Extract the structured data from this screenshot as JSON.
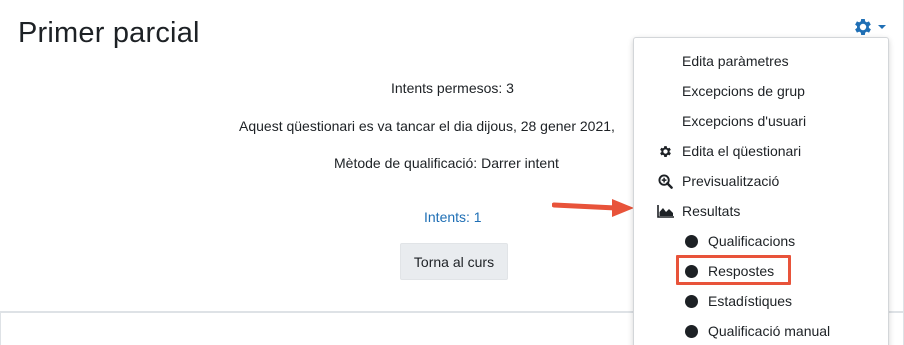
{
  "page": {
    "title": "Primer parcial",
    "info": {
      "attempts_allowed": "Intents permesos: 3",
      "closing_notice": "Aquest qüestionari es va tancar el dia dijous, 28 gener 2021,",
      "grading_method": "Mètode de qualificació: Darrer intent"
    },
    "attempts_link": "Intents: 1",
    "back_button": "Torna al curs"
  },
  "settings_menu": {
    "toggle_icon": "gear-icon",
    "items": [
      {
        "label": "Edita paràmetres",
        "icon": null
      },
      {
        "label": "Excepcions de grup",
        "icon": null
      },
      {
        "label": "Excepcions d'usuari",
        "icon": null
      },
      {
        "label": "Edita el qüestionari",
        "icon": "gear-icon"
      },
      {
        "label": "Previsualització",
        "icon": "magnifier-plus-icon"
      },
      {
        "label": "Resultats",
        "icon": "area-chart-icon"
      },
      {
        "label": "Qualificacions",
        "icon": "bullet-icon"
      },
      {
        "label": "Respostes",
        "icon": "bullet-icon"
      },
      {
        "label": "Estadístiques",
        "icon": "bullet-icon"
      },
      {
        "label": "Qualificació manual",
        "icon": "bullet-icon"
      }
    ]
  },
  "annotation": {
    "highlight_color": "#e8533a",
    "highlighted_item": "Respostes"
  },
  "colors": {
    "link": "#1f6fb5",
    "gear": "#1f6fb5",
    "annotation": "#e8533a"
  }
}
